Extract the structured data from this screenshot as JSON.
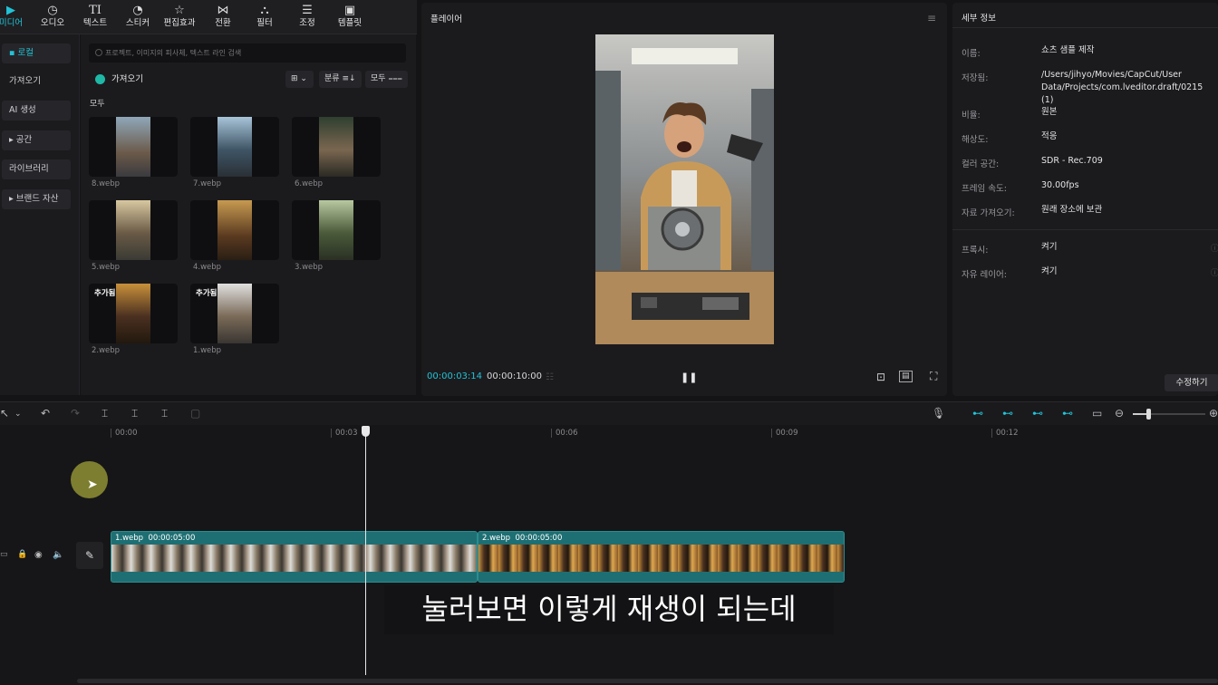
{
  "topbar": {
    "tools": [
      {
        "label": "미디어",
        "icon": "media-icon",
        "active": true
      },
      {
        "label": "오디오",
        "icon": "audio-icon"
      },
      {
        "label": "텍스트",
        "icon": "text-icon"
      },
      {
        "label": "스티커",
        "icon": "sticker-icon"
      },
      {
        "label": "편집효과",
        "icon": "effects-icon"
      },
      {
        "label": "전환",
        "icon": "transition-icon"
      },
      {
        "label": "필터",
        "icon": "filter-icon"
      },
      {
        "label": "조정",
        "icon": "adjust-icon"
      },
      {
        "label": "템플릿",
        "icon": "template-icon"
      }
    ]
  },
  "leftnav": {
    "items": [
      "▪ 로컬",
      "가져오기",
      "AI 생성",
      "▸ 공간",
      "라이브러리",
      "▸ 브랜드 자산"
    ]
  },
  "media": {
    "search_placeholder": "프로젝트, 이미지의 피사체, 텍스트 라인 검색",
    "import_label": "가져오기",
    "sort_label": "분류",
    "filter_label": "모두",
    "section_label": "모두",
    "items": [
      {
        "name": "8.webp",
        "badge": ""
      },
      {
        "name": "7.webp",
        "badge": ""
      },
      {
        "name": "6.webp",
        "badge": ""
      },
      {
        "name": "5.webp",
        "badge": ""
      },
      {
        "name": "4.webp",
        "badge": ""
      },
      {
        "name": "3.webp",
        "badge": ""
      },
      {
        "name": "2.webp",
        "badge": "추가됨"
      },
      {
        "name": "1.webp",
        "badge": "추가됨"
      }
    ]
  },
  "player": {
    "title": "플레이어",
    "current_time": "00:00:03:14",
    "total_time": "00:00:10:00",
    "pause_icon": "pause-icon"
  },
  "details": {
    "title": "세부 정보",
    "rows": [
      {
        "key": "이름:",
        "value": "쇼츠 샘플 제작"
      },
      {
        "key": "저장됨:",
        "value": "/Users/jihyo/Movies/CapCut/User Data/Projects/com.lveditor.draft/0215 (1)"
      },
      {
        "key": "비율:",
        "value": "원본"
      },
      {
        "key": "해상도:",
        "value": "적응"
      },
      {
        "key": "컬러 공간:",
        "value": "SDR - Rec.709"
      },
      {
        "key": "프레임 속도:",
        "value": "30.00fps"
      },
      {
        "key": "자료 가져오기:",
        "value": "원래 장소에 보관"
      },
      {
        "key": "프록시:",
        "value": "켜기"
      },
      {
        "key": "자유 레이어:",
        "value": "켜기"
      }
    ],
    "edit_button": "수정하기"
  },
  "timeline": {
    "ticks": [
      "00:00",
      "00:03",
      "00:06",
      "00:09",
      "00:12"
    ],
    "clips": [
      {
        "name": "1.webp",
        "duration": "00:00:05:00"
      },
      {
        "name": "2.webp",
        "duration": "00:00:05:00"
      }
    ],
    "playhead_seconds": 3.47
  },
  "subtitle": "눌러보면 이렇게 재생이 되는데",
  "colors": {
    "accent": "#22c3d6",
    "clip": "#1e6f73"
  }
}
